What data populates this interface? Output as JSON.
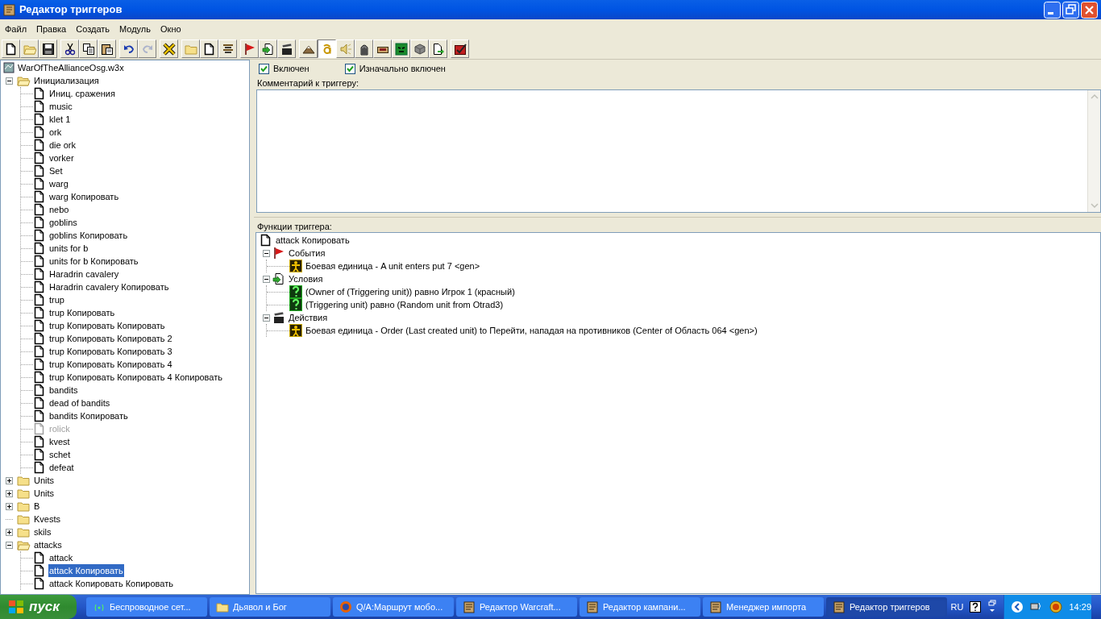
{
  "window": {
    "title": "Редактор триггеров"
  },
  "menu": [
    "Файл",
    "Правка",
    "Создать",
    "Модуль",
    "Окно"
  ],
  "toolbar": [
    {
      "kind": "new",
      "disabled": false,
      "pressed": false
    },
    {
      "kind": "open",
      "disabled": false,
      "pressed": false
    },
    {
      "kind": "save",
      "disabled": false,
      "pressed": false
    },
    {
      "kind": "sep"
    },
    {
      "kind": "cut",
      "disabled": false,
      "pressed": false
    },
    {
      "kind": "copy",
      "disabled": false,
      "pressed": false
    },
    {
      "kind": "paste",
      "disabled": false,
      "pressed": false
    },
    {
      "kind": "sep"
    },
    {
      "kind": "undo",
      "disabled": false,
      "pressed": false
    },
    {
      "kind": "redo",
      "disabled": true,
      "pressed": false
    },
    {
      "kind": "sep"
    },
    {
      "kind": "x",
      "disabled": false,
      "pressed": false
    },
    {
      "kind": "sep"
    },
    {
      "kind": "folder",
      "disabled": false,
      "pressed": false
    },
    {
      "kind": "doc",
      "disabled": false,
      "pressed": false
    },
    {
      "kind": "lines",
      "disabled": false,
      "pressed": false
    },
    {
      "kind": "sep"
    },
    {
      "kind": "flag",
      "disabled": false,
      "pressed": false
    },
    {
      "kind": "condition",
      "disabled": false,
      "pressed": false
    },
    {
      "kind": "clapper",
      "disabled": false,
      "pressed": false
    },
    {
      "kind": "sep"
    },
    {
      "kind": "terrain",
      "disabled": false,
      "pressed": false
    },
    {
      "kind": "letter",
      "disabled": false,
      "pressed": true
    },
    {
      "kind": "sound",
      "disabled": false,
      "pressed": false
    },
    {
      "kind": "unit",
      "disabled": false,
      "pressed": false
    },
    {
      "kind": "object",
      "disabled": false,
      "pressed": false
    },
    {
      "kind": "face",
      "disabled": false,
      "pressed": false
    },
    {
      "kind": "cube",
      "disabled": false,
      "pressed": false
    },
    {
      "kind": "import",
      "disabled": false,
      "pressed": false
    },
    {
      "kind": "sep"
    },
    {
      "kind": "checklist",
      "disabled": false,
      "pressed": false
    }
  ],
  "tree": {
    "root": "WarOfTheAllianceOsg.w3x",
    "children": [
      {
        "kind": "folder",
        "label": "Инициализация",
        "expandable": true,
        "expanded": true,
        "selected": false,
        "children": [
          {
            "kind": "trigger",
            "label": "Иниц. сражения",
            "disabled": false,
            "selected": false
          },
          {
            "kind": "trigger",
            "label": "music",
            "disabled": false,
            "selected": false
          },
          {
            "kind": "trigger",
            "label": "klet 1",
            "disabled": false,
            "selected": false
          },
          {
            "kind": "trigger",
            "label": "ork",
            "disabled": false,
            "selected": false
          },
          {
            "kind": "trigger",
            "label": "die ork",
            "disabled": false,
            "selected": false
          },
          {
            "kind": "trigger",
            "label": "vorker",
            "disabled": false,
            "selected": false
          },
          {
            "kind": "trigger",
            "label": "Set",
            "disabled": false,
            "selected": false
          },
          {
            "kind": "trigger",
            "label": "warg",
            "disabled": false,
            "selected": false
          },
          {
            "kind": "trigger",
            "label": "warg Копировать",
            "disabled": false,
            "selected": false
          },
          {
            "kind": "trigger",
            "label": "nebo",
            "disabled": false,
            "selected": false
          },
          {
            "kind": "trigger",
            "label": "goblins",
            "disabled": false,
            "selected": false
          },
          {
            "kind": "trigger",
            "label": "goblins Копировать",
            "disabled": false,
            "selected": false
          },
          {
            "kind": "trigger",
            "label": "units for b",
            "disabled": false,
            "selected": false
          },
          {
            "kind": "trigger",
            "label": "units for b Копировать",
            "disabled": false,
            "selected": false
          },
          {
            "kind": "trigger",
            "label": "Haradrin cavalery",
            "disabled": false,
            "selected": false
          },
          {
            "kind": "trigger",
            "label": "Haradrin cavalery Копировать",
            "disabled": false,
            "selected": false
          },
          {
            "kind": "trigger",
            "label": "trup",
            "disabled": false,
            "selected": false
          },
          {
            "kind": "trigger",
            "label": "trup Копировать",
            "disabled": false,
            "selected": false
          },
          {
            "kind": "trigger",
            "label": "trup Копировать Копировать",
            "disabled": false,
            "selected": false
          },
          {
            "kind": "trigger",
            "label": "trup Копировать Копировать 2",
            "disabled": false,
            "selected": false
          },
          {
            "kind": "trigger",
            "label": "trup Копировать Копировать 3",
            "disabled": false,
            "selected": false
          },
          {
            "kind": "trigger",
            "label": "trup Копировать Копировать 4",
            "disabled": false,
            "selected": false
          },
          {
            "kind": "trigger",
            "label": "trup Копировать Копировать 4 Копировать",
            "disabled": false,
            "selected": false
          },
          {
            "kind": "trigger",
            "label": "bandits",
            "disabled": false,
            "selected": false
          },
          {
            "kind": "trigger",
            "label": "dead of bandits",
            "disabled": false,
            "selected": false
          },
          {
            "kind": "trigger",
            "label": "bandits Копировать",
            "disabled": false,
            "selected": false
          },
          {
            "kind": "trigger",
            "label": "rolick",
            "disabled": true,
            "selected": false
          },
          {
            "kind": "trigger",
            "label": "kvest",
            "disabled": false,
            "selected": false
          },
          {
            "kind": "trigger",
            "label": "schet",
            "disabled": false,
            "selected": false
          },
          {
            "kind": "trigger",
            "label": "defeat",
            "disabled": false,
            "selected": false
          }
        ]
      },
      {
        "kind": "folder",
        "label": "Units",
        "expandable": true,
        "expanded": false,
        "selected": false
      },
      {
        "kind": "folder",
        "label": "Units",
        "expandable": true,
        "expanded": false,
        "selected": false
      },
      {
        "kind": "folder",
        "label": "B",
        "expandable": true,
        "expanded": false,
        "selected": false
      },
      {
        "kind": "folder",
        "label": "Kvests",
        "expandable": false,
        "expanded": false,
        "selected": false
      },
      {
        "kind": "folder",
        "label": "skils",
        "expandable": true,
        "expanded": false,
        "selected": false
      },
      {
        "kind": "folder",
        "label": "attacks",
        "expandable": true,
        "expanded": true,
        "selected": false,
        "children": [
          {
            "kind": "trigger",
            "label": "attack",
            "disabled": false,
            "selected": false
          },
          {
            "kind": "trigger",
            "label": "attack Копировать",
            "disabled": false,
            "selected": true
          },
          {
            "kind": "trigger",
            "label": "attack Копировать Копировать",
            "disabled": false,
            "selected": false
          }
        ]
      }
    ]
  },
  "trigger": {
    "enabled": {
      "label": "Включен",
      "checked": true
    },
    "initially_on": {
      "label": "Изначально включен",
      "checked": true
    },
    "comment_label": "Комментарий к триггеру:",
    "functions_label": "Функции триггера:",
    "functions": {
      "title": "attack Копировать",
      "sections": [
        {
          "kind": "events",
          "label": "События",
          "expanded": true,
          "items": [
            {
              "kind": "unit",
              "text": "Боевая единица - A unit enters put 7 <gen>"
            }
          ]
        },
        {
          "kind": "conditions",
          "label": "Условия",
          "expanded": true,
          "items": [
            {
              "kind": "question",
              "text": "(Owner of (Triggering unit)) равно Игрок 1 (красный)"
            },
            {
              "kind": "question",
              "text": "(Triggering unit) равно (Random unit from Otrad3)"
            }
          ]
        },
        {
          "kind": "actions",
          "label": "Действия",
          "expanded": true,
          "items": [
            {
              "kind": "unit",
              "text": "Боевая единица - Order (Last created unit) to Перейти, нападая на противников (Center of Область 064 <gen>)"
            }
          ]
        }
      ]
    }
  },
  "taskbar": {
    "start": "пуск",
    "tasks": [
      {
        "kind": "wireless",
        "label": "Беспроводное сет...",
        "selected": false
      },
      {
        "kind": "folder",
        "label": "Дьявол и Бог",
        "selected": false
      },
      {
        "kind": "browser",
        "label": "Q/A:Маршрут мобо...",
        "selected": false
      },
      {
        "kind": "editor",
        "label": "Редактор Warcraft...",
        "selected": false
      },
      {
        "kind": "editor",
        "label": "Редактор кампани...",
        "selected": false
      },
      {
        "kind": "editor",
        "label": "Менеджер импорта",
        "selected": false
      },
      {
        "kind": "editor",
        "label": "Редактор триггеров",
        "selected": true
      }
    ],
    "language": "RU",
    "clock": "14:29"
  }
}
